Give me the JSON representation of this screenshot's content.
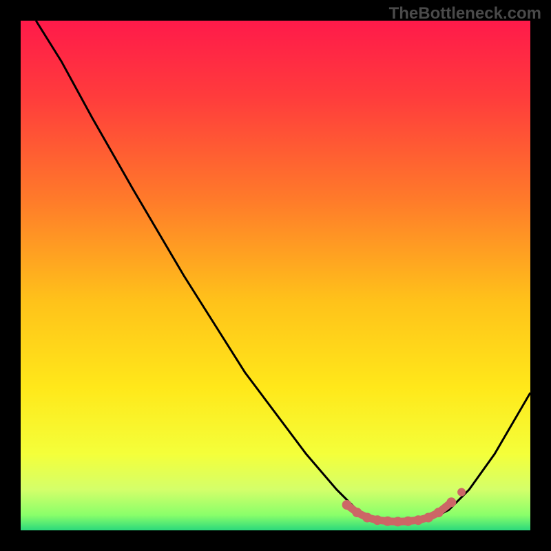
{
  "watermark": "TheBottleneck.com",
  "chart_data": {
    "type": "line",
    "title": "",
    "xlabel": "",
    "ylabel": "",
    "xlim": [
      0,
      100
    ],
    "ylim": [
      0,
      100
    ],
    "gradient": {
      "stops": [
        {
          "offset": 0.0,
          "color": "#ff1a4a"
        },
        {
          "offset": 0.15,
          "color": "#ff3c3c"
        },
        {
          "offset": 0.35,
          "color": "#ff7a2a"
        },
        {
          "offset": 0.55,
          "color": "#ffc21a"
        },
        {
          "offset": 0.72,
          "color": "#ffe81a"
        },
        {
          "offset": 0.85,
          "color": "#f4ff3a"
        },
        {
          "offset": 0.92,
          "color": "#d4ff6a"
        },
        {
          "offset": 0.97,
          "color": "#8aff6a"
        },
        {
          "offset": 1.0,
          "color": "#2bd97c"
        }
      ]
    },
    "series": [
      {
        "name": "bottleneck-curve",
        "color": "#000000",
        "points": [
          {
            "x": 3,
            "y": 100
          },
          {
            "x": 8,
            "y": 92
          },
          {
            "x": 14,
            "y": 81
          },
          {
            "x": 22,
            "y": 67
          },
          {
            "x": 32,
            "y": 50
          },
          {
            "x": 44,
            "y": 31
          },
          {
            "x": 56,
            "y": 15
          },
          {
            "x": 62,
            "y": 8
          },
          {
            "x": 66,
            "y": 4
          },
          {
            "x": 70,
            "y": 2
          },
          {
            "x": 75,
            "y": 1.5
          },
          {
            "x": 80,
            "y": 2
          },
          {
            "x": 84,
            "y": 4
          },
          {
            "x": 88,
            "y": 8
          },
          {
            "x": 93,
            "y": 15
          },
          {
            "x": 100,
            "y": 27
          }
        ]
      },
      {
        "name": "optimal-range-markers",
        "color": "#cc6666",
        "points": [
          {
            "x": 64,
            "y": 5
          },
          {
            "x": 66,
            "y": 3.5
          },
          {
            "x": 68,
            "y": 2.5
          },
          {
            "x": 70,
            "y": 2
          },
          {
            "x": 72,
            "y": 1.8
          },
          {
            "x": 74,
            "y": 1.7
          },
          {
            "x": 76,
            "y": 1.8
          },
          {
            "x": 78,
            "y": 2
          },
          {
            "x": 80,
            "y": 2.5
          },
          {
            "x": 82,
            "y": 3.5
          },
          {
            "x": 84.5,
            "y": 5.5
          }
        ]
      }
    ]
  }
}
